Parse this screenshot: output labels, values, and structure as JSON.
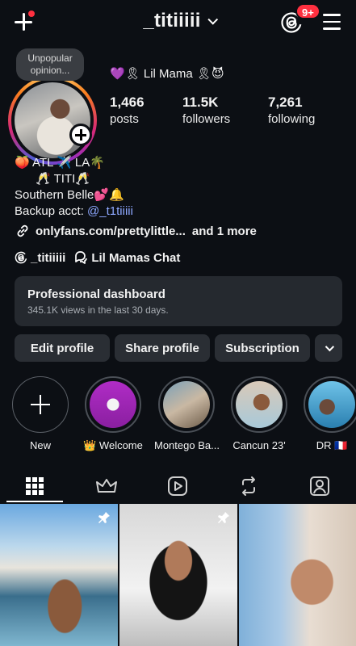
{
  "header": {
    "username": "_titiiiii",
    "notification_badge": "9+"
  },
  "profile": {
    "note": "Unpopular opinion...",
    "display_name": "💜🎗 Lil Mama 🎗😈",
    "stats": [
      {
        "value": "1,466",
        "label": "posts"
      },
      {
        "value": "11.5K",
        "label": "followers"
      },
      {
        "value": "7,261",
        "label": "following"
      }
    ],
    "bio": {
      "line1": "🍑 ATL ✈️ LA🌴",
      "line2": "🥂 TITI🥂",
      "line3": "Southern Belle💕🔔",
      "line4_prefix": "Backup acct: ",
      "line4_handle": "@_t1tiiiii"
    },
    "link": "onlyfans.com/prettylittle...",
    "link_more": "and 1 more",
    "threads_handle": "_titiiiii",
    "chat_name": "Lil Mamas Chat"
  },
  "dashboard": {
    "title": "Professional dashboard",
    "subtitle": "345.1K views in the last 30 days."
  },
  "buttons": {
    "edit": "Edit profile",
    "share": "Share profile",
    "subscription": "Subscription"
  },
  "highlights": [
    {
      "label": "New"
    },
    {
      "label": "👑 Welcome"
    },
    {
      "label": "Montego Ba..."
    },
    {
      "label": "Cancun 23'"
    },
    {
      "label": "DR 🇫🇷"
    }
  ],
  "tabs": [
    "grid-icon",
    "crown-icon",
    "reels-icon",
    "repost-icon",
    "tagged-icon"
  ]
}
